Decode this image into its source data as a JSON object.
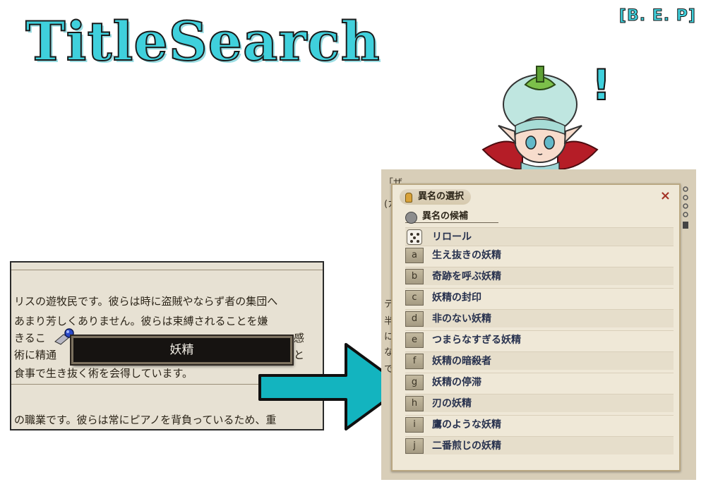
{
  "header": {
    "title": "TitleSearch",
    "credit": "[B. E. P]"
  },
  "left_crop": {
    "lines": [
      "リスの遊牧民です。彼らは時に盗賊やならず者の集団へ",
      "あまり芳しくありません。彼らは束縛されることを嫌",
      "きるこ",
      "術に精通",
      "食事で生き抜く術を会得しています。",
      "の職業です。彼らは常にピアノを背負っているため、重"
    ],
    "line_fragments_right": [
      "感",
      "と"
    ],
    "popup_label": "妖精"
  },
  "mascot": {
    "exclaim": "!"
  },
  "panel": {
    "title": "異名の選択",
    "close_label": "×",
    "sub_title": "異名の候補",
    "reroll_label": "リロール",
    "options": [
      {
        "key": "a",
        "label": "生え抜きの妖精"
      },
      {
        "key": "b",
        "label": "奇跡を呼ぶ妖精"
      },
      {
        "key": "c",
        "label": "妖精の封印"
      },
      {
        "key": "d",
        "label": "非のない妖精"
      },
      {
        "key": "e",
        "label": "つまらなすぎる妖精"
      },
      {
        "key": "f",
        "label": "妖精の暗殺者"
      },
      {
        "key": "g",
        "label": "妖精の停滞"
      },
      {
        "key": "h",
        "label": "刃の妖精"
      },
      {
        "key": "i",
        "label": "鷹のような妖精"
      },
      {
        "key": "j",
        "label": "二番煎じの妖精"
      }
    ]
  },
  "background_fragments": [
    "「ザ",
    "(カ",
    "テ",
    "半",
    "に",
    "な",
    "で"
  ]
}
